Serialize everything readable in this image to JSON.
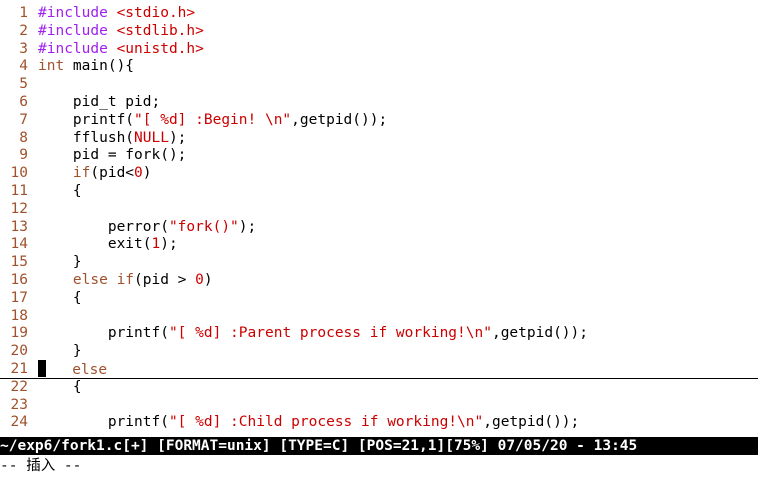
{
  "editor": {
    "lines": [
      {
        "n": "1",
        "parts": [
          {
            "t": "#include ",
            "c": "inc"
          },
          {
            "t": "<stdio.h>",
            "c": "str"
          }
        ]
      },
      {
        "n": "2",
        "parts": [
          {
            "t": "#include ",
            "c": "inc"
          },
          {
            "t": "<stdlib.h>",
            "c": "str"
          }
        ]
      },
      {
        "n": "3",
        "parts": [
          {
            "t": "#include ",
            "c": "inc"
          },
          {
            "t": "<unistd.h>",
            "c": "str"
          }
        ]
      },
      {
        "n": "4",
        "parts": [
          {
            "t": "int",
            "c": "kw"
          },
          {
            "t": " main(){",
            "c": ""
          }
        ]
      },
      {
        "n": "5",
        "parts": []
      },
      {
        "n": "6",
        "parts": [
          {
            "t": "    pid_t pid;",
            "c": ""
          }
        ]
      },
      {
        "n": "7",
        "parts": [
          {
            "t": "    printf(",
            "c": ""
          },
          {
            "t": "\"[ %d] :Begin! \\n\"",
            "c": "str"
          },
          {
            "t": ",getpid());",
            "c": ""
          }
        ]
      },
      {
        "n": "8",
        "parts": [
          {
            "t": "    fflush(",
            "c": ""
          },
          {
            "t": "NULL",
            "c": "num"
          },
          {
            "t": ");",
            "c": ""
          }
        ]
      },
      {
        "n": "9",
        "parts": [
          {
            "t": "    pid = fork();",
            "c": ""
          }
        ]
      },
      {
        "n": "10",
        "parts": [
          {
            "t": "    ",
            "c": ""
          },
          {
            "t": "if",
            "c": "kw"
          },
          {
            "t": "(pid<",
            "c": ""
          },
          {
            "t": "0",
            "c": "num"
          },
          {
            "t": ")",
            "c": ""
          }
        ]
      },
      {
        "n": "11",
        "parts": [
          {
            "t": "    {",
            "c": ""
          }
        ]
      },
      {
        "n": "12",
        "parts": []
      },
      {
        "n": "13",
        "parts": [
          {
            "t": "        perror(",
            "c": ""
          },
          {
            "t": "\"fork()\"",
            "c": "str"
          },
          {
            "t": ");",
            "c": ""
          }
        ]
      },
      {
        "n": "14",
        "parts": [
          {
            "t": "        exit(",
            "c": ""
          },
          {
            "t": "1",
            "c": "num"
          },
          {
            "t": ");",
            "c": ""
          }
        ]
      },
      {
        "n": "15",
        "parts": [
          {
            "t": "    }",
            "c": ""
          }
        ]
      },
      {
        "n": "16",
        "parts": [
          {
            "t": "    ",
            "c": ""
          },
          {
            "t": "else if",
            "c": "kw"
          },
          {
            "t": "(pid > ",
            "c": ""
          },
          {
            "t": "0",
            "c": "num"
          },
          {
            "t": ")",
            "c": ""
          }
        ]
      },
      {
        "n": "17",
        "parts": [
          {
            "t": "    {",
            "c": ""
          }
        ]
      },
      {
        "n": "18",
        "parts": []
      },
      {
        "n": "19",
        "parts": [
          {
            "t": "        printf(",
            "c": ""
          },
          {
            "t": "\"[ %d] :Parent process if working!\\n\"",
            "c": "str"
          },
          {
            "t": ",getpid());",
            "c": ""
          }
        ]
      },
      {
        "n": "20",
        "parts": [
          {
            "t": "    }",
            "c": ""
          }
        ]
      },
      {
        "n": "21",
        "parts": [
          {
            "t": "    ",
            "c": ""
          },
          {
            "t": "else",
            "c": "kw"
          }
        ],
        "cursor": true
      },
      {
        "n": "22",
        "parts": [
          {
            "t": "    {",
            "c": ""
          }
        ]
      },
      {
        "n": "23",
        "parts": []
      },
      {
        "n": "24",
        "parts": [
          {
            "t": "        printf(",
            "c": ""
          },
          {
            "t": "\"[ %d] :Child process if working!\\n\"",
            "c": "str"
          },
          {
            "t": ",getpid());",
            "c": ""
          }
        ]
      }
    ]
  },
  "statusline": {
    "text": "~/exp6/fork1.c[+] [FORMAT=unix] [TYPE=C] [POS=21,1][75%] 07/05/20 - 13:45"
  },
  "cmdline": {
    "text": "-- 插入 --"
  }
}
